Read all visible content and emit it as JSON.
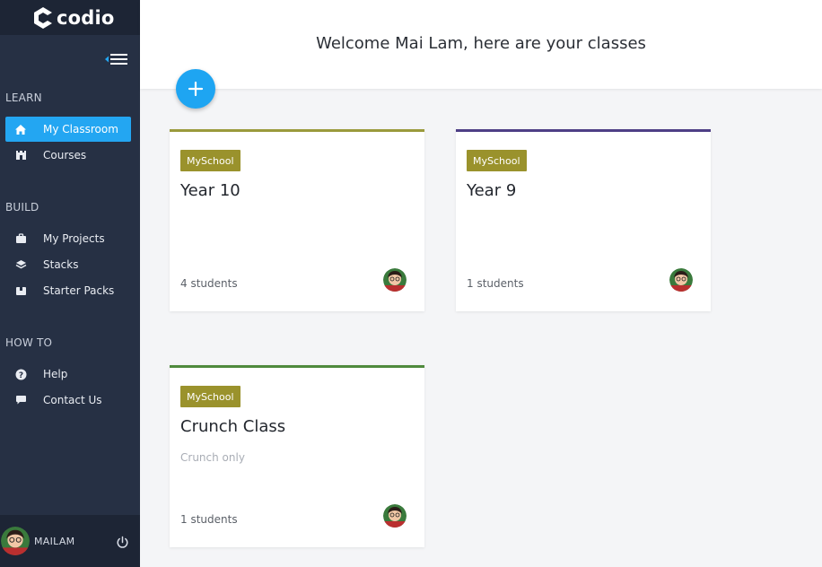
{
  "brand": {
    "name": "codio"
  },
  "sidebar": {
    "sections": {
      "learn": "LEARN",
      "build": "BUILD",
      "howto": "HOW TO"
    },
    "items": [
      {
        "label": "My Classroom",
        "icon": "home-icon",
        "active": true
      },
      {
        "label": "Courses",
        "icon": "castle-icon"
      },
      {
        "label": "My Projects",
        "icon": "briefcase-icon"
      },
      {
        "label": "Stacks",
        "icon": "layers-icon"
      },
      {
        "label": "Starter Packs",
        "icon": "package-icon"
      },
      {
        "label": "Help",
        "icon": "question-icon"
      },
      {
        "label": "Contact Us",
        "icon": "chat-icon"
      }
    ],
    "user": {
      "name": "MAILAM"
    }
  },
  "header": {
    "welcome": "Welcome Mai Lam, here are your classes"
  },
  "classes": [
    {
      "badge": "MySchool",
      "title": "Year 10",
      "subtitle": "",
      "students": "4 students",
      "accent": "#9a9a3c"
    },
    {
      "badge": "MySchool",
      "title": "Year 9",
      "subtitle": "",
      "students": "1 students",
      "accent": "#4e3f86"
    },
    {
      "badge": "MySchool",
      "title": "Crunch Class",
      "subtitle": "Crunch only",
      "students": "1 students",
      "accent": "#4f8a3d"
    }
  ],
  "colors": {
    "accent": "#23a6f2",
    "badge": "#9a922c",
    "sidebar": "#263044"
  }
}
